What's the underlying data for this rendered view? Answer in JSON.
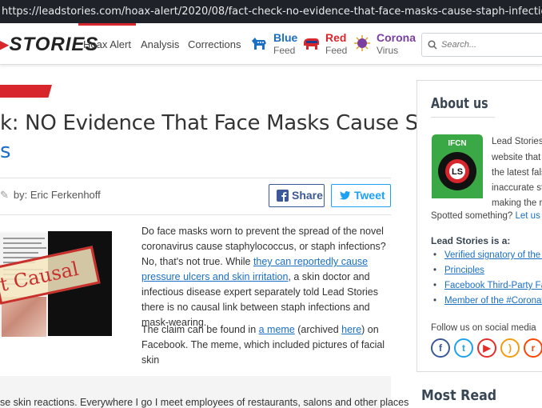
{
  "browser": {
    "url": "https://leadstories.com/hoax-alert/2020/08/fact-check-no-evidence-that-face-masks-cause-staph-infections.html"
  },
  "header": {
    "logo_text": "STORIES",
    "nav": [
      "Hoax Alert",
      "Analysis",
      "Corrections"
    ],
    "feeds": [
      {
        "title": "Blue",
        "sub": "Feed",
        "color": "#1a6fc4",
        "icon": "democrat-donkey-icon"
      },
      {
        "title": "Red",
        "sub": "Feed",
        "color": "#d8262d",
        "icon": "republican-elephant-icon"
      },
      {
        "title": "Corona",
        "sub": "Virus",
        "color": "#7b3fa0",
        "icon": "coronavirus-icon"
      }
    ],
    "search_placeholder": "Search..."
  },
  "article": {
    "title_line1": "k: NO Evidence That Face Masks Cause Staph",
    "title_line2": "s",
    "author": "by: Eric Ferkenhoff",
    "share_facebook": "Share",
    "share_twitter": "Tweet",
    "stamp_text": "t Causal",
    "p1_a": "Do face masks worn to prevent the spread of the novel coronavirus cause staphylococcus, or staph infections? No, that's not true. While ",
    "p1_link": "they can reportedly cause pressure ulcers and skin irritation",
    "p1_b": ", a skin doctor and infectious disease expert separately told Lead Stories there is no causal link between staph infections and mask-wearing.",
    "p2_a": "The claim can be found in ",
    "p2_link1": "a meme",
    "p2_b": " (archived ",
    "p2_link2": "here",
    "p2_c": ") on Facebook. The meme, which included pictures of facial skin",
    "quote_text": "se skin reactions. Everywhere I go I meet employees of restaurants, salons and other places"
  },
  "sidebar": {
    "about_title": "About us",
    "intro_lines": [
      "Lead Stories",
      "website that i",
      "the latest fals",
      "inaccurate sto",
      "making the ro"
    ],
    "spotted_text": "Spotted something? ",
    "spotted_link": "Let us k",
    "is_a": "Lead Stories is a:",
    "items": [
      "Verified signatory of the IF",
      "Principles",
      "Facebook Third-Party Fac",
      "Member of the #Coronavi"
    ],
    "follow": "Follow us on social media",
    "social": [
      {
        "name": "facebook",
        "glyph": "f",
        "color": "#3b5998"
      },
      {
        "name": "twitter",
        "glyph": "t",
        "color": "#1da1f2"
      },
      {
        "name": "youtube",
        "glyph": "▶",
        "color": "#e52d27"
      },
      {
        "name": "rss",
        "glyph": ")",
        "color": "#f39c12"
      },
      {
        "name": "reddit",
        "glyph": "r",
        "color": "#ff4500"
      }
    ],
    "most_read": "Most Read"
  }
}
